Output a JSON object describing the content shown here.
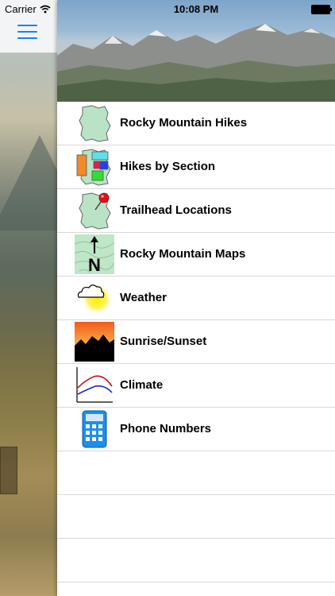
{
  "status_bar": {
    "carrier": "Carrier",
    "time": "10:08 PM"
  },
  "menu": {
    "items": [
      {
        "label": "Rocky Mountain Hikes",
        "icon": "park-map-icon"
      },
      {
        "label": "Hikes by Section",
        "icon": "sectioned-map-icon"
      },
      {
        "label": "Trailhead Locations",
        "icon": "map-pin-icon"
      },
      {
        "label": "Rocky Mountain Maps",
        "icon": "topo-map-north-icon"
      },
      {
        "label": "Weather",
        "icon": "sun-cloud-icon"
      },
      {
        "label": "Sunrise/Sunset",
        "icon": "sunset-mountain-icon"
      },
      {
        "label": "Climate",
        "icon": "climate-chart-icon"
      },
      {
        "label": "Phone Numbers",
        "icon": "calculator-phone-icon"
      }
    ]
  },
  "colors": {
    "accent": "#1a7ff5",
    "map_green": "#b9e3c4"
  }
}
